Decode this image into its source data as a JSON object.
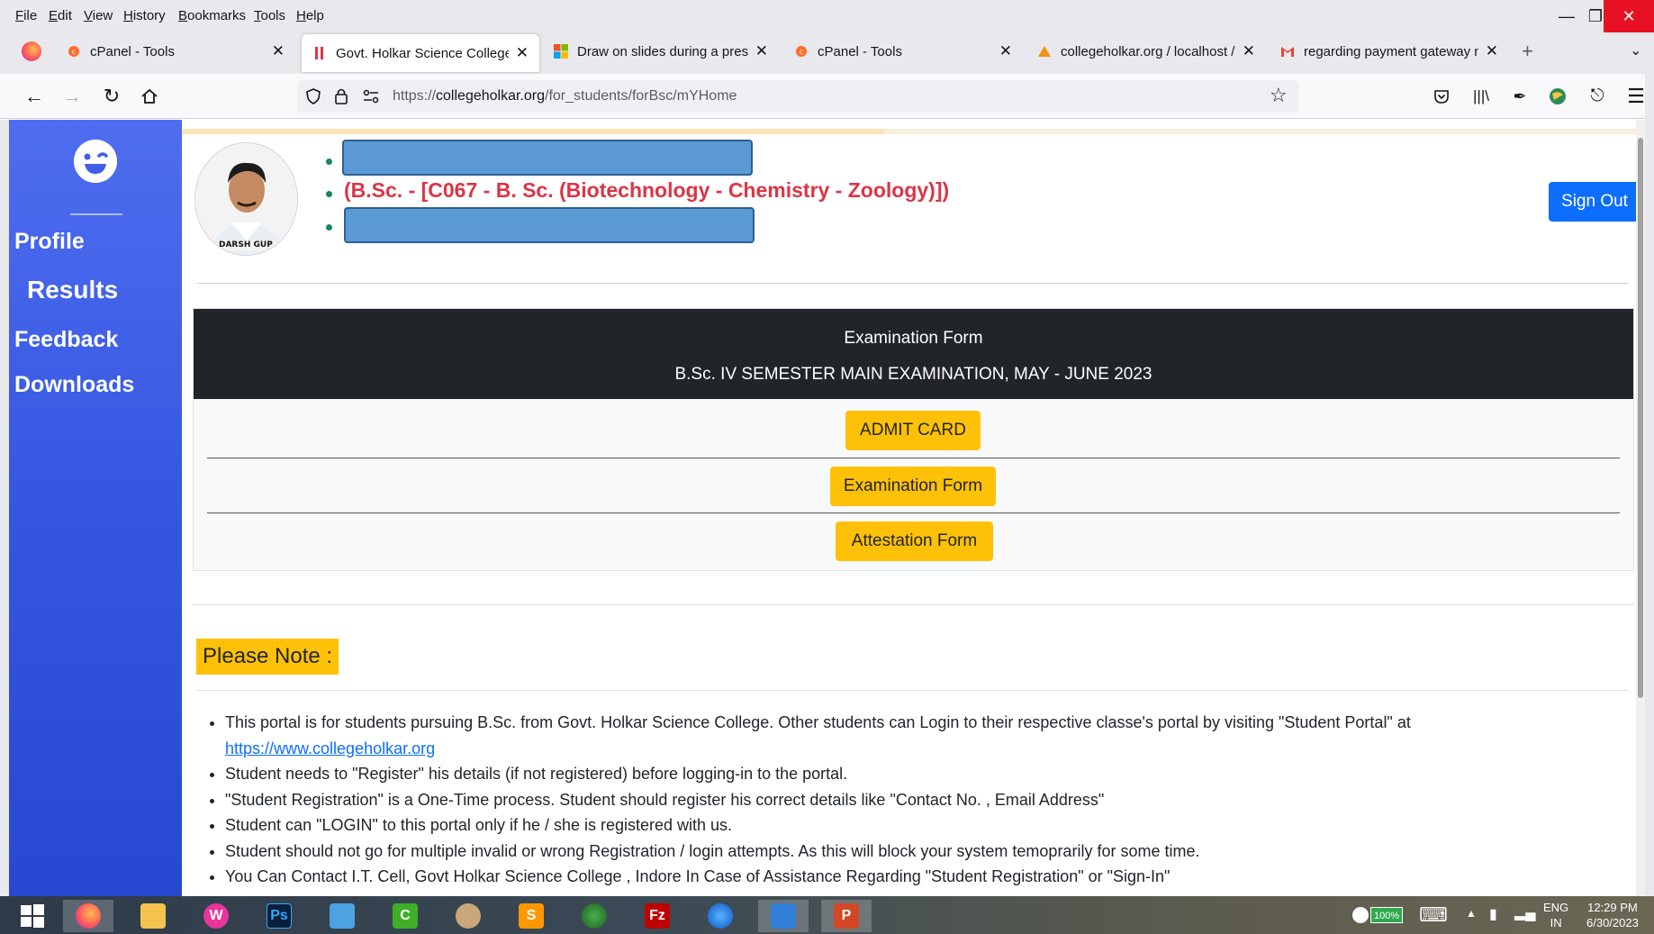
{
  "browser": {
    "menu": [
      "File",
      "Edit",
      "View",
      "History",
      "Bookmarks",
      "Tools",
      "Help"
    ],
    "tabs": [
      {
        "title": "cPanel - Tools",
        "icon": "cpanel-icon",
        "color": "#ff6c2c"
      },
      {
        "title": "Govt. Holkar Science College",
        "icon": "college-icon",
        "color": "#dc3545"
      },
      {
        "title": "Draw on slides during a present",
        "icon": "microsoft-icon",
        "color": "#00a4ef"
      },
      {
        "title": "cPanel - Tools",
        "icon": "cpanel-icon",
        "color": "#ff6c2c"
      },
      {
        "title": "collegeholkar.org / localhost / c",
        "icon": "phpmyadmin-icon",
        "color": "#f29111"
      },
      {
        "title": "regarding payment gateway no",
        "icon": "gmail-icon",
        "color": "#ea4335"
      }
    ],
    "new_tab": "+",
    "url_scheme": "https://",
    "url_domain": "collegeholkar.org",
    "url_path": "/for_students/forBsc/mYHome"
  },
  "sidebar": {
    "items": [
      {
        "label": "Profile"
      },
      {
        "label": "Results"
      },
      {
        "label": "Feedback"
      },
      {
        "label": "Downloads"
      }
    ]
  },
  "profile": {
    "course": "(B.Sc. - [C067 - B. Sc. (Biotechnology - Chemistry - Zoology)])",
    "avatar_caption": "DARSH GUP"
  },
  "header": {
    "sign_out": "Sign Out"
  },
  "exam": {
    "title": "Examination Form",
    "subtitle": "B.Sc. IV SEMESTER MAIN EXAMINATION, MAY - JUNE 2023",
    "buttons": [
      {
        "label": "ADMIT CARD"
      },
      {
        "label": "Examination Form"
      },
      {
        "label": "Attestation Form"
      }
    ]
  },
  "note": {
    "label": "Please Note :",
    "items": [
      "This portal is for students pursuing B.Sc. from Govt. Holkar Science College. Other students can Login to their respective classe's portal by visiting \"Student Portal\" at",
      "Student needs to \"Register\" his details (if not registered) before logging-in to the portal.",
      "\"Student Registration\" is a One-Time process. Student should register his correct details like \"Contact No. , Email Address\"",
      "Student can \"LOGIN\" to this portal only if he / she is registered with us.",
      "Student should not go for multiple invalid or wrong Registration / login attempts. As this will block your system temoprarily for some time.",
      "You Can Contact I.T. Cell, Govt Holkar Science College , Indore In Case of Assistance Regarding \"Student Registration\" or \"Sign-In\""
    ],
    "link": "https://www.collegeholkar.org"
  },
  "taskbar": {
    "apps": [
      {
        "name": "firefox",
        "text": ""
      },
      {
        "name": "file-explorer",
        "text": ""
      },
      {
        "name": "wamp",
        "text": "W"
      },
      {
        "name": "photoshop",
        "text": "Ps"
      },
      {
        "name": "control-panel",
        "text": ""
      },
      {
        "name": "camtasia",
        "text": "C"
      },
      {
        "name": "paint",
        "text": ""
      },
      {
        "name": "sublime-text",
        "text": "S"
      },
      {
        "name": "globe-app",
        "text": ""
      },
      {
        "name": "filezilla",
        "text": "Fz"
      },
      {
        "name": "thunderbird",
        "text": ""
      },
      {
        "name": "remote-desktop",
        "text": ""
      },
      {
        "name": "powerpoint",
        "text": "P"
      }
    ],
    "battery": "100%",
    "lang_top": "ENG",
    "lang_bottom": "IN",
    "time": "12:29 PM",
    "date": "6/30/2023"
  }
}
